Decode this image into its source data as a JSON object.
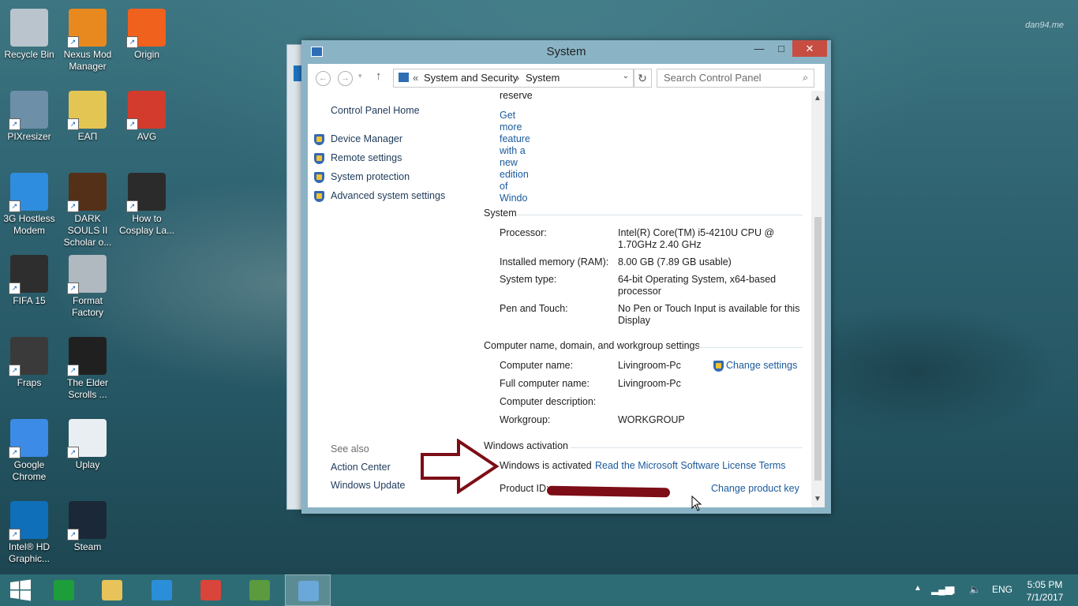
{
  "desktop": {
    "watermark": "dan94.me",
    "icons": [
      {
        "label": "Recycle Bin",
        "color": "#b9c4cc"
      },
      {
        "label": "Nexus Mod Manager",
        "color": "#e8891f"
      },
      {
        "label": "Origin",
        "color": "#f0611e"
      },
      {
        "label": "PIXresizer",
        "color": "#6d8fa8"
      },
      {
        "label": "ΕΑΠ",
        "color": "#e3c553"
      },
      {
        "label": "AVG",
        "color": "#d33b2c"
      },
      {
        "label": "3G Hostless Modem",
        "color": "#2f8de0"
      },
      {
        "label": "DARK SOULS II Scholar o...",
        "color": "#553018"
      },
      {
        "label": "How to Cosplay La...",
        "color": "#2b2b2b"
      },
      {
        "label": "FIFA 15",
        "color": "#2e2e2e"
      },
      {
        "label": "Format Factory",
        "color": "#b0b9c0"
      },
      {
        "label": "Fraps",
        "color": "#3a3a3a"
      },
      {
        "label": "The Elder Scrolls ...",
        "color": "#202020"
      },
      {
        "label": "Google Chrome",
        "color": "#3c8be6"
      },
      {
        "label": "Uplay",
        "color": "#e9eef2"
      },
      {
        "label": "Intel® HD Graphic...",
        "color": "#0f6fb8"
      },
      {
        "label": "Steam",
        "color": "#1b2838"
      }
    ]
  },
  "window": {
    "title": "System",
    "controls": {
      "minimize": "—",
      "maximize": "□",
      "close": "✕"
    },
    "address": {
      "prefix": "«",
      "crumbs": [
        "System and Security",
        "System"
      ],
      "separator": "›"
    },
    "search_placeholder": "Search Control Panel",
    "left_pane": {
      "home": "Control Panel Home",
      "links": [
        "Device Manager",
        "Remote settings",
        "System protection",
        "Advanced system settings"
      ],
      "see_also_heading": "See also",
      "see_also": [
        "Action Center",
        "Windows Update"
      ]
    },
    "upgrade": {
      "reserve_text": "reserve",
      "link_lines": [
        "Get",
        "more",
        "feature",
        "with a",
        "new",
        "edition",
        "of",
        "Windo"
      ]
    },
    "system_section": {
      "heading": "System",
      "rows": [
        {
          "label": "Processor:",
          "value": "Intel(R) Core(TM) i5-4210U CPU @ 1.70GHz 2.40 GHz"
        },
        {
          "label": "Installed memory (RAM):",
          "value": "8.00 GB (7.89 GB usable)"
        },
        {
          "label": "System type:",
          "value": "64-bit Operating System, x64-based processor"
        },
        {
          "label": "Pen and Touch:",
          "value": "No Pen or Touch Input is available for this Display"
        }
      ]
    },
    "computer_section": {
      "heading": "Computer name, domain, and workgroup settings",
      "change_settings": "Change settings",
      "rows": [
        {
          "label": "Computer name:",
          "value": "Livingroom-Pc"
        },
        {
          "label": "Full computer name:",
          "value": "Livingroom-Pc"
        },
        {
          "label": "Computer description:",
          "value": ""
        },
        {
          "label": "Workgroup:",
          "value": "WORKGROUP"
        }
      ]
    },
    "activation_section": {
      "heading": "Windows activation",
      "status": "Windows is activated",
      "license_link": "Read the Microsoft Software License Terms",
      "product_id_label": "Product ID:",
      "change_key": "Change product key"
    }
  },
  "taskbar": {
    "items": [
      {
        "name": "store",
        "color": "#1e9e3a"
      },
      {
        "name": "file-explorer",
        "color": "#e8c35a"
      },
      {
        "name": "internet-explorer",
        "color": "#2a8fd8"
      },
      {
        "name": "chrome",
        "color": "#d9453a"
      },
      {
        "name": "avg",
        "color": "#5b9a3e"
      },
      {
        "name": "control-panel",
        "color": "#6aa8d9"
      }
    ],
    "language": "ENG",
    "time": "5:05 PM",
    "date": "7/1/2017"
  },
  "colors": {
    "link": "#1a5a9c",
    "redaction": "#7d0d16",
    "arrow": "#7d0d16",
    "close": "#c74d42"
  }
}
